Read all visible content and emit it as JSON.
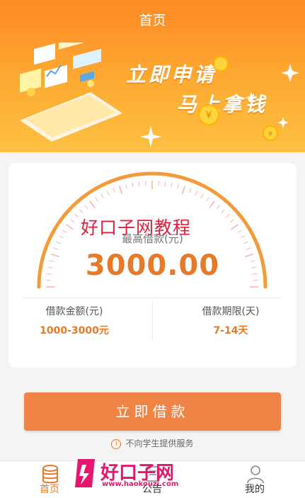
{
  "header": {
    "title": "首页"
  },
  "banner": {
    "line1": "立即申请",
    "line2": "马上拿钱"
  },
  "watermark": {
    "text": "好口子网教程",
    "logo_text": "好口子网",
    "logo_url": "www.haokouzi.com"
  },
  "loan_card": {
    "max_label": "最高借款(元)",
    "max_value": "3000.00",
    "amount_label": "借款金额(元)",
    "amount_value": "1000-3000元",
    "term_label": "借款期限(天)",
    "term_value": "7-14天"
  },
  "apply_button": {
    "label": "立即借款"
  },
  "notice": {
    "icon": "info-icon",
    "text": "不向学生提供服务"
  },
  "tabbar": {
    "items": [
      {
        "label": "首页",
        "icon": "coins-stack-icon",
        "active": true
      },
      {
        "label": "公告",
        "icon": "announcement-icon",
        "active": false
      },
      {
        "label": "我的",
        "icon": "user-icon",
        "active": false
      }
    ]
  },
  "colors": {
    "accent": "#e7792a",
    "header_top": "#fd8a24",
    "header_bottom": "#fdc042",
    "button": "#f08447"
  }
}
